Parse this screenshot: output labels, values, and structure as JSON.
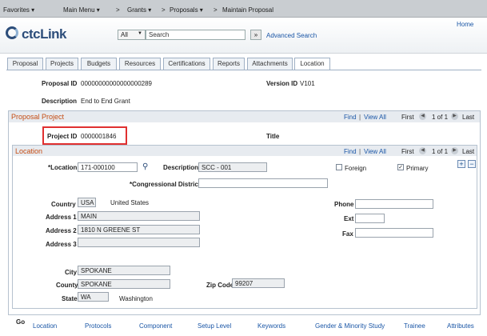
{
  "topnav": {
    "favorites": "Favorites ▾",
    "main_menu": "Main Menu ▾",
    "sep1": ">",
    "grants": "Grants ▾",
    "sep2": ">",
    "proposals": "Proposals ▾",
    "sep3": ">",
    "current": "Maintain Proposal"
  },
  "header": {
    "logo": "ctcLink",
    "home": "Home",
    "search_scope": "All",
    "search_placeholder": "Search",
    "go_symbol": "»",
    "advanced_search": "Advanced Search"
  },
  "tabs": [
    "Proposal",
    "Projects",
    "Budgets",
    "Resources",
    "Certifications",
    "Reports",
    "Attachments",
    "Location"
  ],
  "proposal": {
    "proposal_id_label": "Proposal ID",
    "proposal_id": "00000000000000000289",
    "version_id_label": "Version ID",
    "version_id": "V101",
    "description_label": "Description",
    "description": "End to End Grant"
  },
  "proposal_project": {
    "heading": "Proposal Project",
    "find": "Find",
    "view_all": "View All",
    "first": "First",
    "range": "1 of 1",
    "last": "Last",
    "project_id_label": "Project ID",
    "project_id": "0000001846",
    "title_label": "Title"
  },
  "location": {
    "heading": "Location",
    "find": "Find",
    "view_all": "View All",
    "first": "First",
    "range": "1 of 1",
    "last": "Last",
    "add": "+",
    "remove": "−",
    "location_label": "*Location",
    "location_value": "171-000100",
    "description_label": "Description",
    "description_value": "SCC - 001",
    "foreign_label": "Foreign",
    "primary_label": "Primary",
    "congressional_label": "*Congressional District",
    "congressional_value": "",
    "country_label": "Country",
    "country_value": "USA",
    "country_name": "United States",
    "phone_label": "Phone",
    "phone_value": "",
    "address1_label": "Address 1",
    "address1_value": "MAIN",
    "ext_label": "Ext",
    "ext_value": "",
    "address2_label": "Address 2",
    "address2_value": "1810 N GREENE ST",
    "fax_label": "Fax",
    "fax_value": "",
    "address3_label": "Address 3",
    "address3_value": "",
    "city_label": "City",
    "city_value": "SPOKANE",
    "county_label": "County",
    "county_value": "SPOKANE",
    "zip_label": "Zip Code",
    "zip_value": "99207",
    "state_label": "State",
    "state_value": "WA",
    "state_name": "Washington"
  },
  "bottom_links": {
    "go": "Go",
    "items": [
      "Location",
      "Protocols",
      "Component",
      "Setup Level",
      "Keywords",
      "Gender & Minority Study",
      "Trainee",
      "Attributes"
    ]
  }
}
